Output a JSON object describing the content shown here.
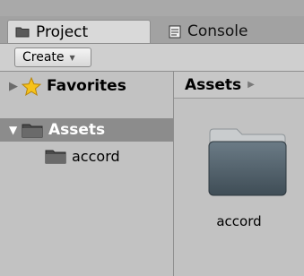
{
  "tabs": [
    {
      "label": "Project",
      "icon": "folder-icon"
    },
    {
      "label": "Console",
      "icon": "console-icon"
    }
  ],
  "toolbar": {
    "create_label": "Create"
  },
  "sidebar": {
    "favorites_label": "Favorites",
    "assets_label": "Assets",
    "children": [
      {
        "label": "accord"
      }
    ]
  },
  "main": {
    "breadcrumb": "Assets",
    "items": [
      {
        "label": "accord",
        "icon": "folder-icon"
      }
    ]
  }
}
